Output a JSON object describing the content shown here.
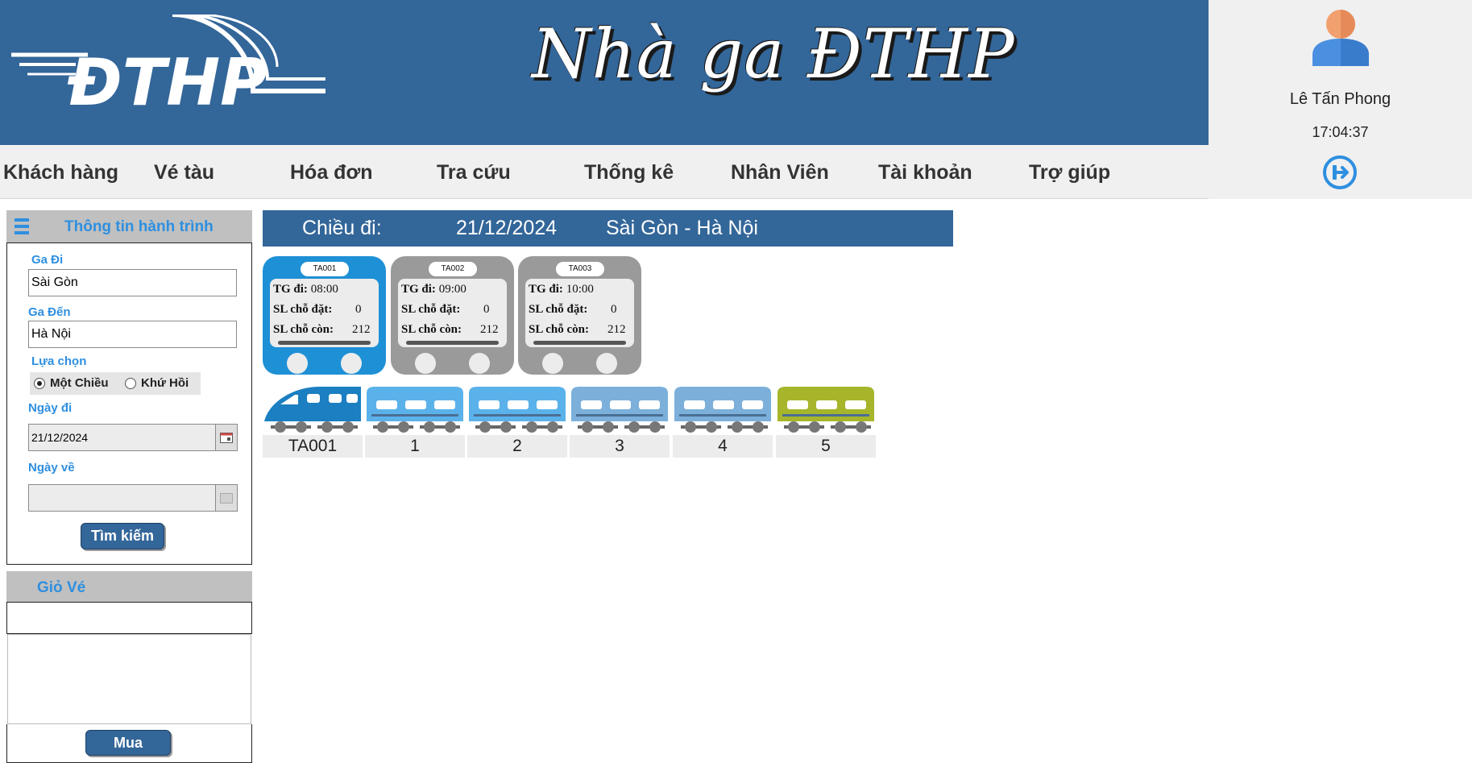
{
  "header": {
    "logo_text": "ĐTHP",
    "title": "Nhà ga ĐTHP"
  },
  "user": {
    "name": "Lê Tấn Phong",
    "clock": "17:04:37"
  },
  "menu": [
    "Khách hàng",
    "Vé tàu",
    "Hóa đơn",
    "Tra cứu",
    "Thống kê",
    "Nhân Viên",
    "Tài khoản",
    "Trợ giúp"
  ],
  "journey": {
    "title": "Thông tin hành trình",
    "from_label": "Ga Đi",
    "from_value": "Sài Gòn",
    "to_label": "Ga Đến",
    "to_value": "Hà Nội",
    "option_label": "Lựa chọn",
    "one_way": "Một Chiều",
    "round_trip": "Khứ Hồi",
    "depart_label": "Ngày đi",
    "depart_value": "21/12/2024",
    "return_label": "Ngày về",
    "return_value": "",
    "search_button": "Tìm kiếm"
  },
  "cart": {
    "title": "Giỏ Vé",
    "buy_button": "Mua"
  },
  "trip": {
    "direction_label": "Chiều đi:",
    "date": "21/12/2024",
    "route": "Sài Gòn - Hà Nội"
  },
  "trains": [
    {
      "code": "TA001",
      "dep_label": "TG đi:",
      "dep_time": "08:00",
      "booked_label": "SL chỗ đặt:",
      "booked": "0",
      "remain_label": "SL chỗ còn:",
      "remain": "212",
      "selected": true
    },
    {
      "code": "TA002",
      "dep_label": "TG đi:",
      "dep_time": "09:00",
      "booked_label": "SL chỗ đặt:",
      "booked": "0",
      "remain_label": "SL chỗ còn:",
      "remain": "212",
      "selected": false
    },
    {
      "code": "TA003",
      "dep_label": "TG đi:",
      "dep_time": "10:00",
      "booked_label": "SL chỗ đặt:",
      "booked": "0",
      "remain_label": "SL chỗ còn:",
      "remain": "212",
      "selected": false
    }
  ],
  "composition": [
    "TA001",
    "1",
    "2",
    "3",
    "4",
    "5"
  ],
  "colors": {
    "brand": "#336699",
    "accent_text": "#2e8fe0",
    "active_card": "#1e90d6",
    "idle_card": "#9a9a9a",
    "locomotive": "#1b7fc1",
    "car_blue": "#5bb2ea",
    "car_light": "#7cb0db",
    "car_last": "#a7b52a"
  }
}
